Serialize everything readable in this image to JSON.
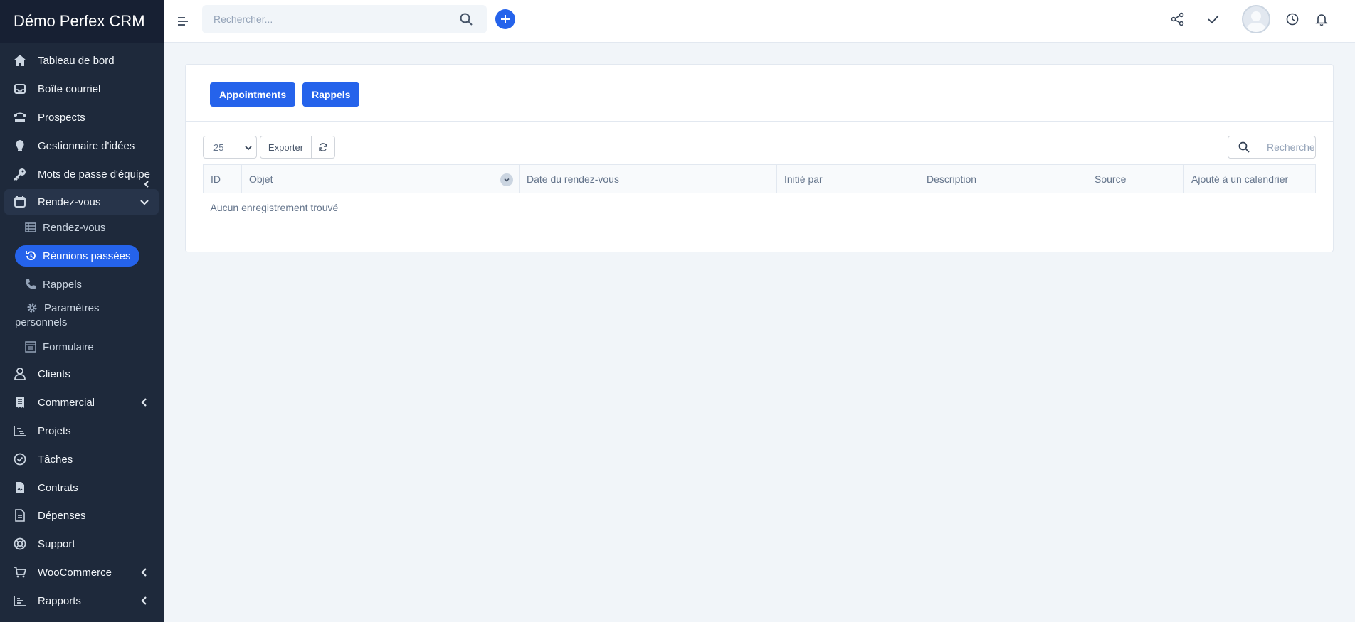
{
  "app": {
    "title": "Démo Perfex CRM"
  },
  "sidebar": {
    "items": [
      {
        "label": "Tableau de bord",
        "icon": "home-icon"
      },
      {
        "label": "Boîte courriel",
        "icon": "mail-icon"
      },
      {
        "label": "Prospects",
        "icon": "tty-icon"
      },
      {
        "label": "Gestionnaire d'idées",
        "icon": "lightbulb-icon"
      },
      {
        "label": "Mots de passe d'équipe",
        "icon": "key-icon"
      },
      {
        "label": "Rendez-vous",
        "icon": "calendar-icon",
        "expanded": true
      },
      {
        "label": "Clients",
        "icon": "user-icon"
      },
      {
        "label": "Commercial",
        "icon": "receipt-icon"
      },
      {
        "label": "Projets",
        "icon": "chart-icon"
      },
      {
        "label": "Tâches",
        "icon": "check-circle-icon"
      },
      {
        "label": "Contrats",
        "icon": "file-icon"
      },
      {
        "label": "Dépenses",
        "icon": "document-icon"
      },
      {
        "label": "Support",
        "icon": "lifebuoy-icon"
      },
      {
        "label": "WooCommerce",
        "icon": "cart-icon"
      },
      {
        "label": "Rapports",
        "icon": "bar-chart-icon"
      }
    ],
    "subitems": [
      {
        "label": "Rendez-vous",
        "icon": "table-icon"
      },
      {
        "label": "Réunions passées",
        "icon": "history-icon",
        "active": true
      },
      {
        "label": "Rappels",
        "icon": "phone-icon"
      },
      {
        "label": "Paramètres personnels",
        "icon": "gear-icon"
      },
      {
        "label": "Formulaire",
        "icon": "form-icon"
      }
    ]
  },
  "topbar": {
    "search_placeholder": "Rechercher..."
  },
  "tabs": {
    "appointments": "Appointments",
    "reminders": "Rappels"
  },
  "table_controls": {
    "page_size": "25",
    "export_label": "Exporter",
    "search_placeholder": "Rechercher"
  },
  "table": {
    "columns": [
      "ID",
      "Objet",
      "Date du rendez-vous",
      "Initié par",
      "Description",
      "Source",
      "Ajouté à un calendrier"
    ],
    "empty_message": "Aucun enregistrement trouvé"
  },
  "colors": {
    "sidebar": "#1e293b",
    "accent": "#2563eb",
    "background": "#f1f5f9"
  }
}
